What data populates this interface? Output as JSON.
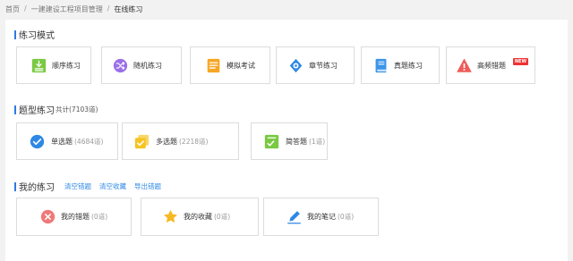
{
  "breadcrumb": [
    "首页",
    "一建建设工程项目管理",
    "在线练习"
  ],
  "breadcrumb_sep": "/",
  "practice_modes": {
    "title": "练习模式",
    "items": [
      {
        "label": "顺序练习",
        "icon": "list-icon",
        "color": "#7ac943"
      },
      {
        "label": "随机练习",
        "icon": "shuffle-icon",
        "color": "#9b6fe8"
      },
      {
        "label": "模拟考试",
        "icon": "exam-paper-icon",
        "color": "#f6a623"
      },
      {
        "label": "章节练习",
        "icon": "chapter-target-icon",
        "color": "#2e88e6"
      },
      {
        "label": "真题练习",
        "icon": "book-icon",
        "color": "#3b96e8"
      },
      {
        "label": "高频错题",
        "icon": "warning-icon",
        "color": "#f05a5a",
        "badge": "NEW"
      }
    ]
  },
  "question_types": {
    "title": "题型练习",
    "subtitle": "共计(7103道)",
    "items": [
      {
        "label": "单选题",
        "count": "(4684道)",
        "icon": "check-circle-icon",
        "color": "#2e88e6"
      },
      {
        "label": "多选题",
        "count": "(2218道)",
        "icon": "multi-check-icon",
        "color": "#f6c323"
      },
      {
        "label": "简答题",
        "count": "(1道)",
        "icon": "short-answer-icon",
        "color": "#7ac943"
      }
    ]
  },
  "my_practice": {
    "title": "我的练习",
    "links": [
      "清空错题",
      "清空收藏",
      "导出错题"
    ],
    "items": [
      {
        "label": "我的错题",
        "count": "(0道)",
        "icon": "wrong-circle-icon",
        "color": "#f07878"
      },
      {
        "label": "我的收藏",
        "count": "(0道)",
        "icon": "star-icon",
        "color": "#f6b923"
      },
      {
        "label": "我的笔记",
        "count": "(0道)",
        "icon": "pencil-icon",
        "color": "#2e88e6"
      }
    ]
  },
  "colors": {
    "accent": "#2e7be6",
    "link": "#2e88e6",
    "background": "#f2f2f2"
  }
}
